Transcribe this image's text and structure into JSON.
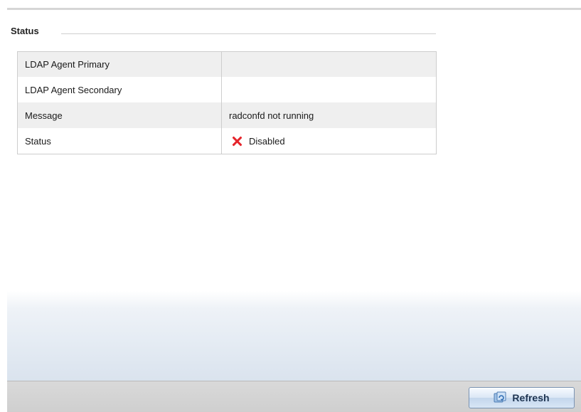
{
  "section": {
    "title": "Status"
  },
  "status_table": {
    "rows": [
      {
        "label": "LDAP Agent Primary",
        "value": ""
      },
      {
        "label": "LDAP Agent Secondary",
        "value": ""
      },
      {
        "label": "Message",
        "value": "radconfd not running"
      },
      {
        "label": "Status",
        "value": "Disabled",
        "icon": "disabled-x-icon"
      }
    ]
  },
  "footer": {
    "refresh_label": "Refresh",
    "refresh_icon": "refresh-icon"
  },
  "colors": {
    "disabled_icon": "#e5242b",
    "button_text": "#1f3552"
  }
}
